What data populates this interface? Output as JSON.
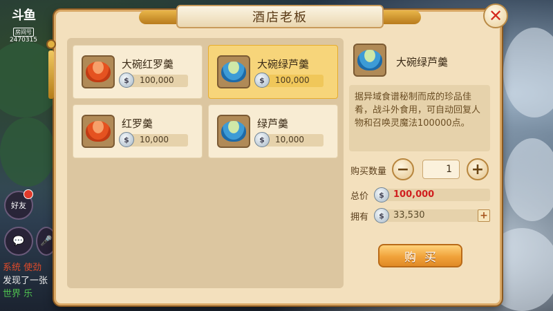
{
  "overlay": {
    "brand_logo": "斗鱼",
    "room_label": "房间号",
    "room_id": "2470315",
    "friends_label": "好友",
    "chat_lines": [
      "系统  使劲",
      "发现了一张",
      "世界  乐"
    ]
  },
  "dialog": {
    "title": "酒店老板",
    "close_icon": "✕"
  },
  "items": [
    {
      "name": "大碗红罗羹",
      "price": "100,000",
      "color": "red",
      "selected": false
    },
    {
      "name": "大碗绿芦羹",
      "price": "100,000",
      "color": "green",
      "selected": true
    },
    {
      "name": "红罗羹",
      "price": "10,000",
      "color": "red",
      "selected": false
    },
    {
      "name": "绿芦羹",
      "price": "10,000",
      "color": "green",
      "selected": false
    }
  ],
  "detail": {
    "name": "大碗绿芦羹",
    "description": "据异域食谱秘制而成的珍品佳肴，战斗外食用，可自动回复人物和召唤灵魔法100000点。",
    "qty_label": "购买数量",
    "qty_minus": "−",
    "qty_plus": "+",
    "qty_value": "1",
    "total_label": "总价",
    "total_value": "100,000",
    "owned_label": "拥有",
    "owned_value": "33,530",
    "add_label": "+",
    "buy_label": "购买"
  },
  "coin_glyph": "$"
}
